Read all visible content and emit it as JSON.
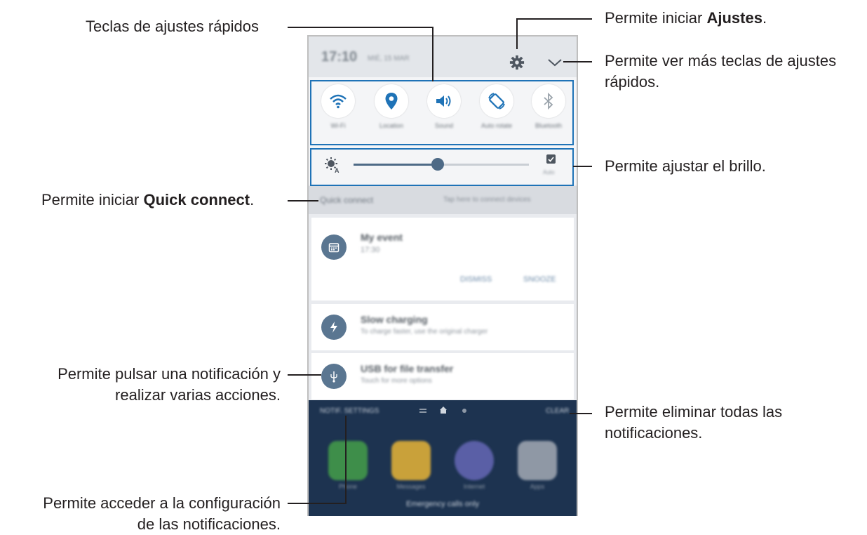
{
  "callouts": {
    "quick_settings": "Teclas de ajustes rápidos",
    "settings_prefix": "Permite iniciar ",
    "settings_bold": "Ajustes",
    "settings_suffix": ".",
    "more_keys_1": "Permite ver más teclas de ajustes",
    "more_keys_2": "rápidos.",
    "brightness": "Permite ajustar el brillo.",
    "quick_connect_prefix": "Permite iniciar ",
    "quick_connect_bold": "Quick connect",
    "quick_connect_suffix": ".",
    "tap_notification_1": "Permite pulsar una notificación y",
    "tap_notification_2": "realizar varias acciones.",
    "clear_all_1": "Permite eliminar todas las",
    "clear_all_2": "notificaciones.",
    "notif_settings_1": "Permite acceder a la configuración",
    "notif_settings_2": "de las notificaciones."
  },
  "phone": {
    "status_time": "17:10",
    "status_date": "MIÉ, 15 MAR",
    "quick_settings": [
      {
        "label": "Wi-Fi",
        "icon": "wifi-icon"
      },
      {
        "label": "Location",
        "icon": "location-icon"
      },
      {
        "label": "Sound",
        "icon": "sound-icon"
      },
      {
        "label": "Auto rotate",
        "icon": "rotate-icon"
      },
      {
        "label": "Bluetooth",
        "icon": "bluetooth-icon"
      }
    ],
    "brightness_level": 0.48,
    "brightness_auto": "Auto",
    "quick_connect_label": "Quick connect",
    "quick_connect_hint": "Tap here to connect devices",
    "notifications": [
      {
        "title": "My event",
        "text": "17:30",
        "icon": "calendar-icon",
        "actions": [
          "DISMISS",
          "SNOOZE"
        ]
      },
      {
        "title": "Slow charging",
        "text": "To charge faster, use the original charger",
        "icon": "bolt-icon"
      },
      {
        "title": "USB for file transfer",
        "text": "Touch for more options",
        "icon": "usb-icon"
      }
    ],
    "notif_settings_label": "NOTIF. SETTINGS",
    "clear_label": "CLEAR",
    "apps": [
      "Phone",
      "Messages",
      "Internet",
      "Apps"
    ],
    "emergency_text": "Emergency calls only"
  }
}
